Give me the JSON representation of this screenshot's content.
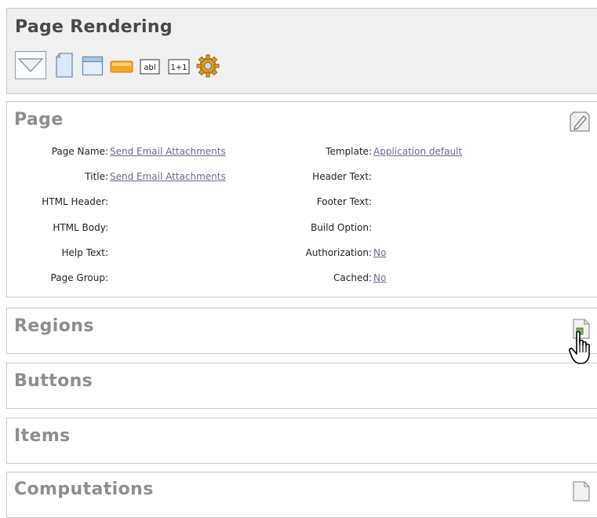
{
  "page_rendering": {
    "title": "Page Rendering",
    "toolbar": [
      {
        "icon": "filter-icon"
      },
      {
        "icon": "page-icon"
      },
      {
        "icon": "region-icon"
      },
      {
        "icon": "button-icon"
      },
      {
        "icon": "text-item-icon",
        "text": "abl"
      },
      {
        "icon": "computation-icon",
        "text": "1+1"
      },
      {
        "icon": "process-gear-icon"
      }
    ]
  },
  "page_section": {
    "title": "Page",
    "left": [
      {
        "label": "Page Name:",
        "value": "Send Email Attachments"
      },
      {
        "label": "Title:",
        "value": "Send Email Attachments"
      },
      {
        "label": "HTML Header:",
        "value": ""
      },
      {
        "label": "HTML Body:",
        "value": ""
      },
      {
        "label": "Help Text:",
        "value": ""
      },
      {
        "label": "Page Group:",
        "value": ""
      }
    ],
    "right": [
      {
        "label": "Template:",
        "value": "Application default"
      },
      {
        "label": "Header Text:",
        "value": ""
      },
      {
        "label": "Footer Text:",
        "value": ""
      },
      {
        "label": "Build Option:",
        "value": ""
      },
      {
        "label": "Authorization:",
        "value": "No"
      },
      {
        "label": "Cached:",
        "value": "No"
      }
    ]
  },
  "regions": {
    "title": "Regions"
  },
  "buttons": {
    "title": "Buttons"
  },
  "items": {
    "title": "Items"
  },
  "computations": {
    "title": "Computations"
  },
  "colors": {
    "link": "#6a6a8a",
    "panel_bg": "#f0f0f0",
    "border": "#c8c8c8"
  }
}
